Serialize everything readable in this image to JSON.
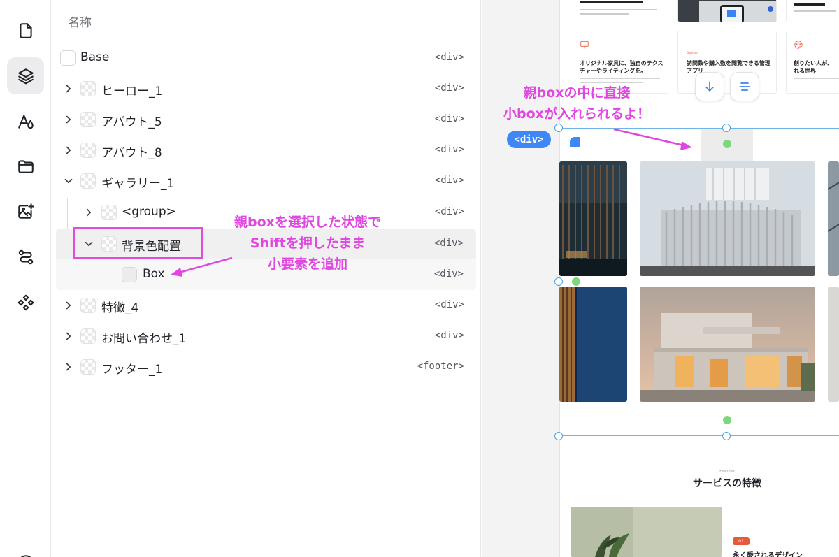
{
  "panel": {
    "header": "名称"
  },
  "layers": [
    {
      "label": "Base",
      "tag": "<div>"
    },
    {
      "label": "ヒーロー_1",
      "tag": "<div>"
    },
    {
      "label": "アバウト_5",
      "tag": "<div>"
    },
    {
      "label": "アバウト_8",
      "tag": "<div>"
    },
    {
      "label": "ギャラリー_1",
      "tag": "<div>"
    },
    {
      "label": "<group>",
      "tag": "<div>"
    },
    {
      "label": "背景色配置",
      "tag": "<div>"
    },
    {
      "label": "Box",
      "tag": "<div>"
    },
    {
      "label": "特徴_4",
      "tag": "<div>"
    },
    {
      "label": "お問い合わせ_1",
      "tag": "<div>"
    },
    {
      "label": "フッター_1",
      "tag": "<footer>"
    }
  ],
  "annotations": {
    "left_line1": "親boxを選択した状態で",
    "left_line2": "Shiftを押したまま",
    "left_line3": "小要素を追加",
    "right_line1": "親boxの中に直接",
    "right_line2": "小boxが入れられるよ！"
  },
  "canvas": {
    "selection_badge": "<div>",
    "cards": [
      {
        "title1": "オリジナル家具に、独自のテクス",
        "title2": "チャーやライティングを。"
      },
      {
        "kicker": "Daptive",
        "title1": "訪問数や購入数を閲覧できる管理",
        "title2": "アプリ"
      },
      {
        "title1": "創りたい人が、",
        "title2": "れる世界"
      }
    ],
    "features_kicker": "Features",
    "features_title": "サービスの特徴",
    "feature_badge": "01",
    "feature_heading": "永く愛されるデザイン"
  },
  "colors": {
    "accent_blue": "#3f87f5",
    "annotation_pink": "#e047e0",
    "selection_line": "#6fb3e8",
    "handle_green": "#7dd87d",
    "feature_orange": "#e8583a"
  },
  "icons": [
    "file-icon",
    "layers-icon",
    "typography-icon",
    "folder-icon",
    "image-add-icon",
    "route-icon",
    "component-icon"
  ]
}
